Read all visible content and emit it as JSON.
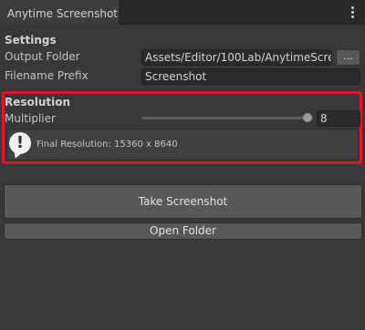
{
  "window": {
    "tab_title": "Anytime Screenshot",
    "menu_icon": "kebab-menu-icon"
  },
  "settings": {
    "title": "Settings",
    "output_folder_label": "Output Folder",
    "output_folder_value": "Assets/Editor/100Lab/AnytimeScree",
    "browse_label": "...",
    "filename_prefix_label": "Filename Prefix",
    "filename_prefix_value": "Screenshot"
  },
  "resolution": {
    "title": "Resolution",
    "multiplier_label": "Multiplier",
    "multiplier_value": "8",
    "warning_icon": "exclamation-info-icon",
    "final_resolution_text": "Final Resolution: 15360 x 8640",
    "highlight_color": "#e3171e"
  },
  "actions": {
    "take_screenshot_label": "Take Screenshot",
    "open_folder_label": "Open Folder"
  }
}
